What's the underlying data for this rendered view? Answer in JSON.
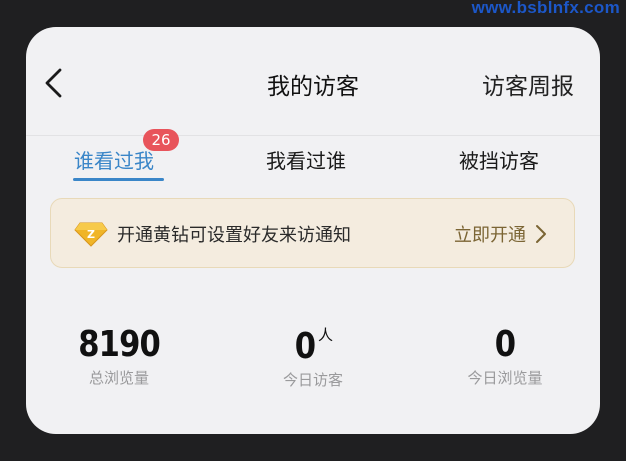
{
  "watermark": "www.bsblnfx.com",
  "header": {
    "title": "我的访客",
    "weekly_report": "访客周报"
  },
  "tabs": [
    {
      "label": "谁看过我",
      "badge": "26",
      "active": true
    },
    {
      "label": "我看过谁",
      "active": false
    },
    {
      "label": "被挡访客",
      "active": false
    }
  ],
  "promo": {
    "text": "开通黄钻可设置好友来访通知",
    "cta": "立即开通"
  },
  "stats": [
    {
      "value": "8190",
      "unit": "",
      "label": "总浏览量"
    },
    {
      "value": "0",
      "unit": "人",
      "label": "今日访客"
    },
    {
      "value": "0",
      "unit": "",
      "label": "今日浏览量"
    }
  ],
  "colors": {
    "accent": "#3a86c8",
    "badge": "#e8545b",
    "promo_bg": "#f4ecdf",
    "promo_cta": "#7b6534"
  }
}
